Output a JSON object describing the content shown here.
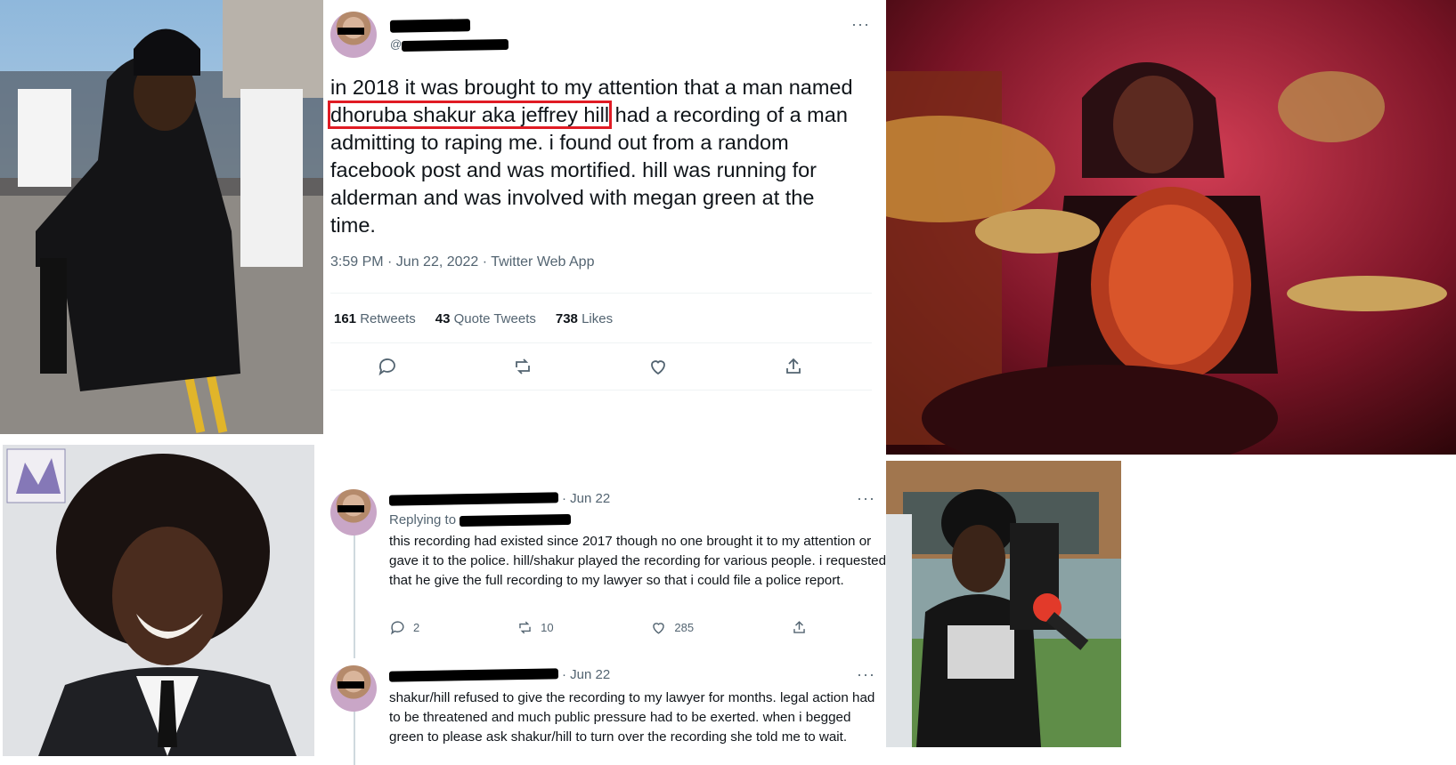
{
  "main_tweet": {
    "text_before": "in 2018 it was brought to my attention that a man named ",
    "text_highlight": "dhoruba shakur aka jeffrey hill",
    "text_after": " had a recording of a man admitting to raping me. i found out from a random facebook post and was mortified. hill was running for alderman and was involved with megan green at the time.",
    "meta": "3:59 PM · Jun 22, 2022 · Twitter Web App",
    "stats": {
      "retweets_count": "161",
      "retweets_label": "Retweets",
      "quotes_count": "43",
      "quotes_label": "Quote Tweets",
      "likes_count": "738",
      "likes_label": "Likes"
    },
    "handle_prefix": "@",
    "more": "···"
  },
  "replies": [
    {
      "date": "· Jun 22",
      "replying_to": "Replying to",
      "text": "this recording had existed since 2017 though no one brought it to my attention or gave it to the police. hill/shakur played the recording for various people. i requested that he give the full recording to my lawyer so that i could file a police report.",
      "reply_count": "2",
      "retweet_count": "10",
      "like_count": "285",
      "more": "···"
    },
    {
      "date": "· Jun 22",
      "text": "shakur/hill refused to give the recording to my lawyer for months. legal action had to be threatened and much public pressure had to be exerted. when i begged green to please ask shakur/hill to turn over the recording she told me to wait.",
      "more": "···"
    }
  ],
  "icons": {
    "reply": "reply-icon",
    "retweet": "retweet-icon",
    "like": "heart-icon",
    "share": "share-icon"
  },
  "colors": {
    "highlight_box": "#e01b24",
    "secondary_text": "#536471"
  }
}
